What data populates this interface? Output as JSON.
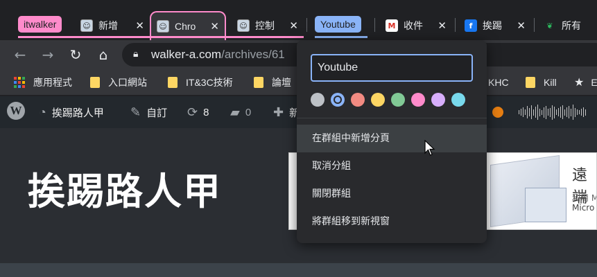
{
  "tabstrip": {
    "groups": [
      {
        "label": "itwalker",
        "color": "#ff8bcb"
      },
      {
        "label": "Youtube",
        "color": "#8ab4f8"
      }
    ],
    "tabs": [
      {
        "title": "新增",
        "favicon": "avatar-icon"
      },
      {
        "title": "Chro",
        "favicon": "avatar-icon",
        "active": true
      },
      {
        "title": "控制",
        "favicon": "avatar-icon"
      },
      {
        "title": "收件",
        "favicon": "gmail-icon"
      },
      {
        "title": "挨踢",
        "favicon": "facebook-icon"
      },
      {
        "title": "所有",
        "favicon": "evernote-icon"
      }
    ],
    "close_glyph": "✕"
  },
  "toolbar": {
    "url_host": "walker-a.com",
    "url_path": "/archives/61"
  },
  "bookmarks": [
    {
      "label": "應用程式",
      "icon": "apps-grid-icon"
    },
    {
      "label": "入口網站",
      "icon": "folder-icon"
    },
    {
      "label": "IT&3C技術",
      "icon": "folder-icon"
    },
    {
      "label": "論壇",
      "icon": "folder-icon"
    },
    {
      "label": "KHC",
      "icon": "none"
    },
    {
      "label": "Kill",
      "icon": "folder-icon"
    },
    {
      "label": "E",
      "icon": "star-icon"
    }
  ],
  "wpbar": {
    "site_name": "挨踢路人甲",
    "customize": "自訂",
    "updates_count": "8",
    "comments_count": "0",
    "new_label": "新"
  },
  "page": {
    "site_title": "挨踢路人甲",
    "ad": {
      "headline": "遠端",
      "line1": "利用 M",
      "line2": "Micro"
    }
  },
  "group_editor": {
    "name_value": "Youtube",
    "colors": [
      "#bdc1c6",
      "#8ab4f8",
      "#f28b82",
      "#fdd663",
      "#81c995",
      "#ff8bcb",
      "#d7aefb",
      "#78d9ec"
    ],
    "selected_color_index": 1,
    "menu": {
      "new_tab": "在群組中新增分頁",
      "ungroup": "取消分組",
      "close_group": "關閉群組",
      "move_to_window": "將群組移到新視窗"
    }
  }
}
